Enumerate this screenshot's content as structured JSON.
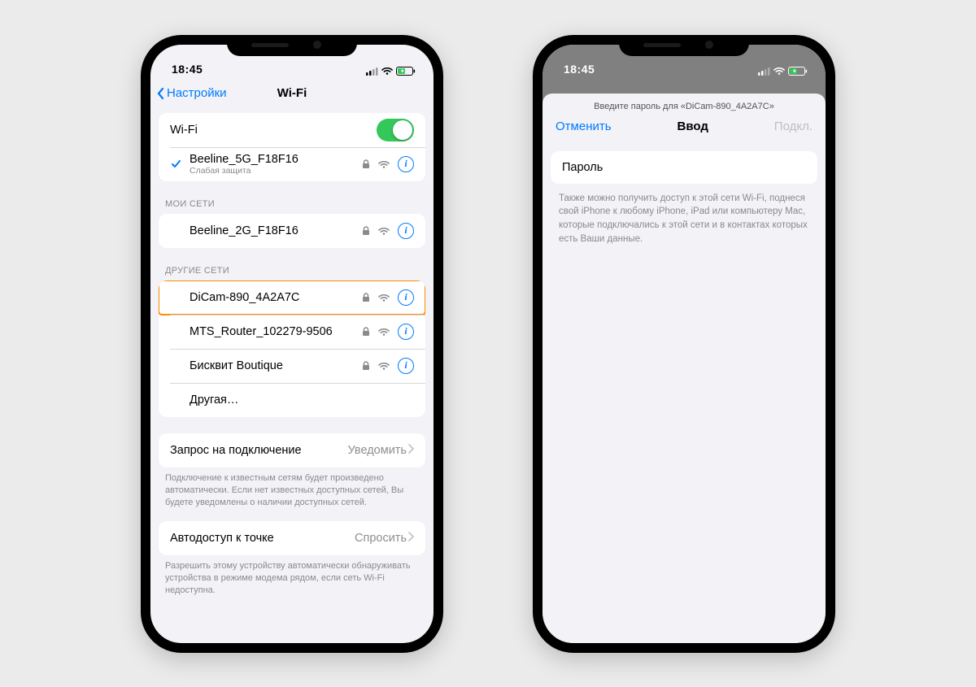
{
  "status": {
    "time": "18:45"
  },
  "phone1": {
    "back": "Настройки",
    "title": "Wi-Fi",
    "wifi_label": "Wi-Fi",
    "connected": {
      "name": "Beeline_5G_F18F16",
      "sub": "Слабая защита"
    },
    "my_header": "МОИ СЕТИ",
    "my": [
      {
        "name": "Beeline_2G_F18F16"
      }
    ],
    "other_header": "ДРУГИЕ СЕТИ",
    "other": [
      {
        "name": "DiCam-890_4A2A7C"
      },
      {
        "name": "MTS_Router_102279-9506"
      },
      {
        "name": "Бисквит Boutique"
      }
    ],
    "other_more": "Другая…",
    "ask": {
      "label": "Запрос на подключение",
      "value": "Уведомить"
    },
    "ask_footer": "Подключение к известным сетям будет произведено автоматически. Если нет известных доступных сетей, Вы будете уведомлены о наличии доступных сетей.",
    "auto": {
      "label": "Автодоступ к точке",
      "value": "Спросить"
    },
    "auto_footer": "Разрешить этому устройству автоматически обнаруживать устройства в режиме модема рядом, если сеть Wi-Fi недоступна."
  },
  "phone2": {
    "prompt": "Введите пароль для «DiCam-890_4A2A7C»",
    "cancel": "Отменить",
    "title": "Ввод",
    "connect": "Подкл.",
    "password_label": "Пароль",
    "hint": "Также можно получить доступ к этой сети Wi-Fi, поднеся свой iPhone к любому iPhone, iPad или компьютеру Mac, которые подключались к этой сети и в контактах которых есть Ваши данные."
  }
}
